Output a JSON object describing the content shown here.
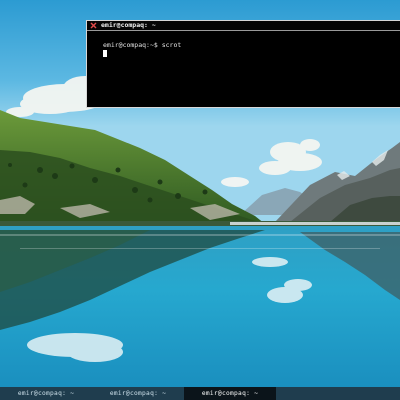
{
  "terminal": {
    "title": "emir@compaq: ~",
    "prompt_line": "emir@compaq:~$ scrot",
    "close_icon": "close-x-icon"
  },
  "taskbar": {
    "tasks": [
      {
        "label": "emir@compaq: ~",
        "active": false
      },
      {
        "label": "emir@compaq: ~",
        "active": false
      },
      {
        "label": "emir@compaq: ~",
        "active": true
      }
    ]
  },
  "colors": {
    "terminal_bg": "#000000",
    "taskbar_bg": "#1f3d4e",
    "taskbar_active_bg": "#0b141a",
    "close_icon": "#e04a4a"
  }
}
